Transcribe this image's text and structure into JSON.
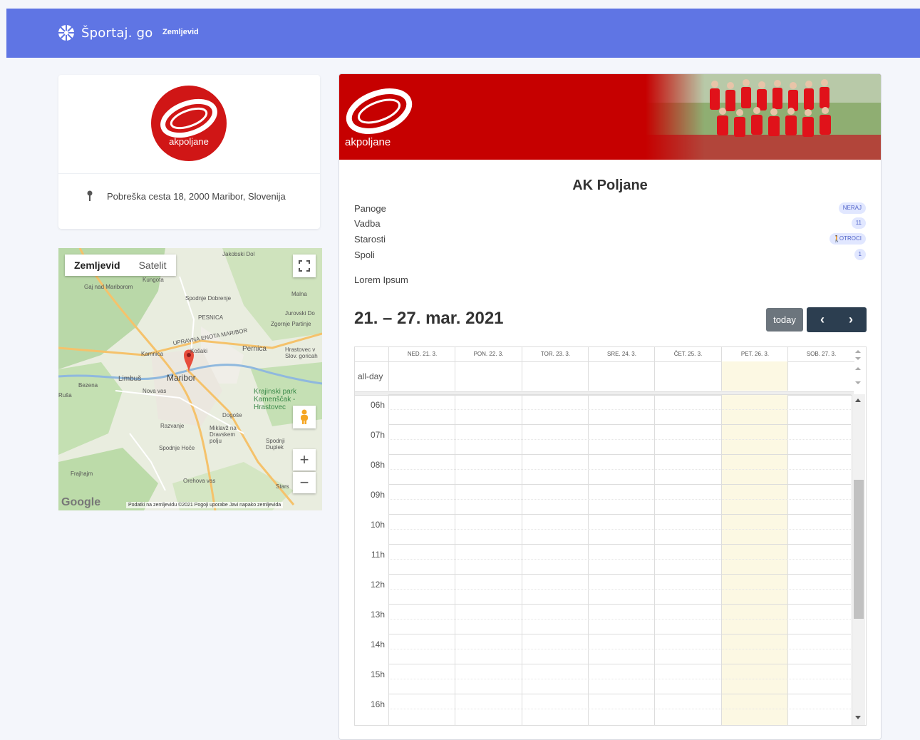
{
  "navbar": {
    "brand": "Športaj. go",
    "link": "Zemljevid",
    "color": "#5f75e4"
  },
  "club_card": {
    "logo_text": "akpoljane",
    "address": "Pobreška cesta 18, 2000 Maribor, Slovenija",
    "icon": "map-pin-icon"
  },
  "map": {
    "tab_map": "Zemljevid",
    "tab_satellite": "Satelit",
    "labels": {
      "maribor": "Maribor",
      "limbus": "Limbuš",
      "kamnica": "Kamnica",
      "pekre": "Bezena",
      "nova_vas": "Nova vas",
      "pesnica": "PESNICA",
      "spodnje_dobrenje": "Spodnje Dobrenje",
      "malna": "Malna",
      "jakobski_dol": "Jakobski Dol",
      "jurovski_dol": "Jurovski Do",
      "zgornje_partinje": "Zgornje Partinje",
      "pernica": "Pernica",
      "kosaki": "Košaki",
      "hrastovec": "Hrastovec v Slov. goricah",
      "krajinski_park": "Krajinski park Kamenščak - Hrastovec",
      "dogose": "Dogoše",
      "razvanje": "Razvanje",
      "miklavz": "Miklavž na Dravskem polju",
      "spodnje_hoce": "Spodnje Hoče",
      "spodnji_duplek": "Spodnji Duplek",
      "orehova_vas": "Orehova vas",
      "fram": "Frajhajm",
      "rusa": "Ruša",
      "kungota": "Kungota",
      "gaj": "Gaj nad Mariborom",
      "upravna": "UPRAVNA ENOTA MARIBOR",
      "stars": "Stars"
    },
    "google": "Google",
    "footer": "Podatki na zemljevidu ©2021   Pogoji uporabe   Javi napako zemljevida"
  },
  "club": {
    "banner_logo": "akpoljane",
    "name": "AK Poljane",
    "rows": [
      {
        "label": "Panoge",
        "badge": "NERAJ"
      },
      {
        "label": "Vadba",
        "badge": "11"
      },
      {
        "label": "Starosti",
        "badge": "OTROCI"
      },
      {
        "label": "Spoli",
        "badge": "1"
      }
    ],
    "description": "Lorem Ipsum"
  },
  "calendar": {
    "title": "21. – 27. mar. 2021",
    "today_label": "today",
    "prev_icon": "‹",
    "next_icon": "›",
    "allday_label": "all-day",
    "days": [
      "NED. 21. 3.",
      "PON. 22. 3.",
      "TOR. 23. 3.",
      "SRE. 24. 3.",
      "ČET. 25. 3.",
      "PET. 26. 3.",
      "SOB. 27. 3."
    ],
    "today_index": 5,
    "hours": [
      "06h",
      "07h",
      "08h",
      "09h",
      "10h",
      "11h",
      "12h",
      "13h",
      "14h",
      "15h",
      "16h"
    ],
    "today_color": "#fcf8e3"
  }
}
